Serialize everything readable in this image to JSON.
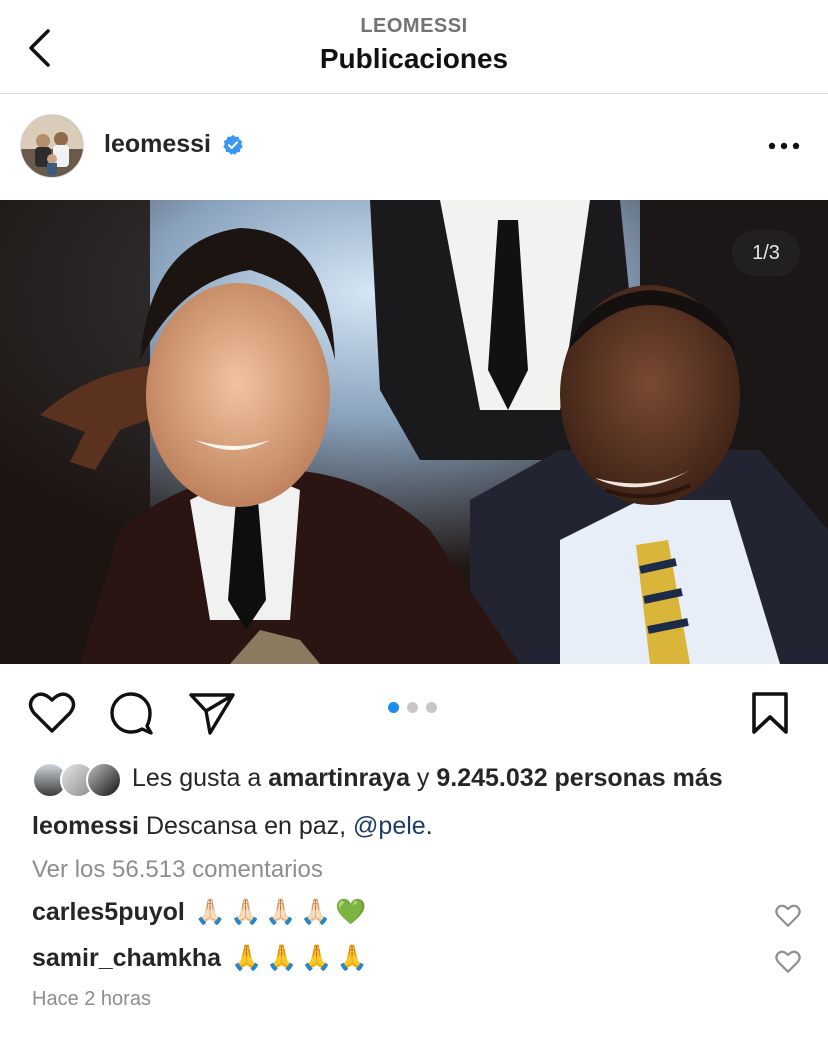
{
  "header": {
    "subtitle": "LEOMESSI",
    "title": "Publicaciones"
  },
  "post": {
    "username": "leomessi",
    "verified": true,
    "image_counter": "1/3",
    "carousel": {
      "total": 3,
      "active_index": 0
    },
    "likes": {
      "prefix": "Les gusta a ",
      "user": "amartinraya",
      "middle": " y ",
      "count_text": "9.245.032 personas más"
    },
    "caption": {
      "username": "leomessi",
      "text": " Descansa en paz, ",
      "mention": "@pele",
      "suffix": "."
    },
    "view_comments": "Ver los 56.513 comentarios",
    "comments": [
      {
        "username": "carles5puyol",
        "emojis": [
          "🙏🏻",
          "🙏🏻",
          "🙏🏻",
          "🙏🏻",
          "💚"
        ]
      },
      {
        "username": "samir_chamkha",
        "emojis": [
          "🙏",
          "🙏",
          "🙏",
          "🙏"
        ]
      }
    ],
    "timestamp": "Hace 2 horas"
  },
  "icons": {
    "back": "chevron-left-icon",
    "more": "more-horizontal-icon",
    "like": "heart-icon",
    "comment": "comment-icon",
    "share": "send-icon",
    "save": "bookmark-icon",
    "verified": "verified-badge-icon"
  },
  "colors": {
    "accent": "#1d8cf0",
    "verified": "#3897f0",
    "mention": "#1f3c66",
    "muted": "#8e8e8e",
    "text": "#262626"
  }
}
